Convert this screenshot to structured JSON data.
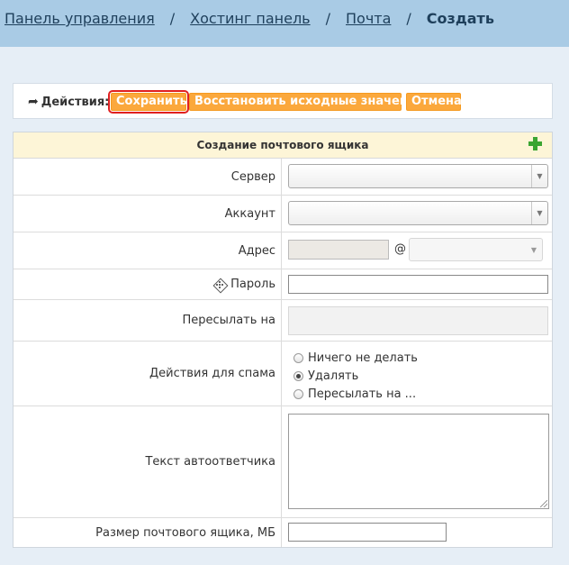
{
  "breadcrumb": {
    "items": [
      "Панель управления",
      "Хостинг панель",
      "Почта"
    ],
    "separator": "/",
    "current": "Создать"
  },
  "actions": {
    "label": "Действия:",
    "save_label": "Сохранить",
    "restore_label": "Восстановить исходные значения",
    "cancel_label": "Отмена"
  },
  "form": {
    "title": "Создание почтового ящика",
    "fields": {
      "server": {
        "label": "Сервер",
        "value": ""
      },
      "account": {
        "label": "Аккаунт",
        "value": ""
      },
      "address": {
        "label": "Адрес",
        "value": "",
        "at": "@",
        "domain": ""
      },
      "password": {
        "label": "Пароль",
        "value": ""
      },
      "forward": {
        "label": "Пересылать на",
        "value": ""
      },
      "spam": {
        "label": "Действия для спама",
        "options": [
          "Ничего не делать",
          "Удалять",
          "Пересылать на ..."
        ],
        "selected": "Удалять"
      },
      "autoreply": {
        "label": "Текст автоответчика",
        "value": ""
      },
      "size": {
        "label": "Размер почтового ящика, МБ",
        "value": ""
      }
    }
  },
  "icons": {
    "actions": "share-arrow-icon",
    "add": "plus-icon",
    "password_generator": "dice-icon",
    "dropdown": "chevron-down-icon"
  },
  "colors": {
    "topbar": "#a9cbe5",
    "page_bg": "#e6eef6",
    "button": "#fba83c",
    "form_header": "#fdf5d7",
    "add_icon": "#3aa532"
  }
}
